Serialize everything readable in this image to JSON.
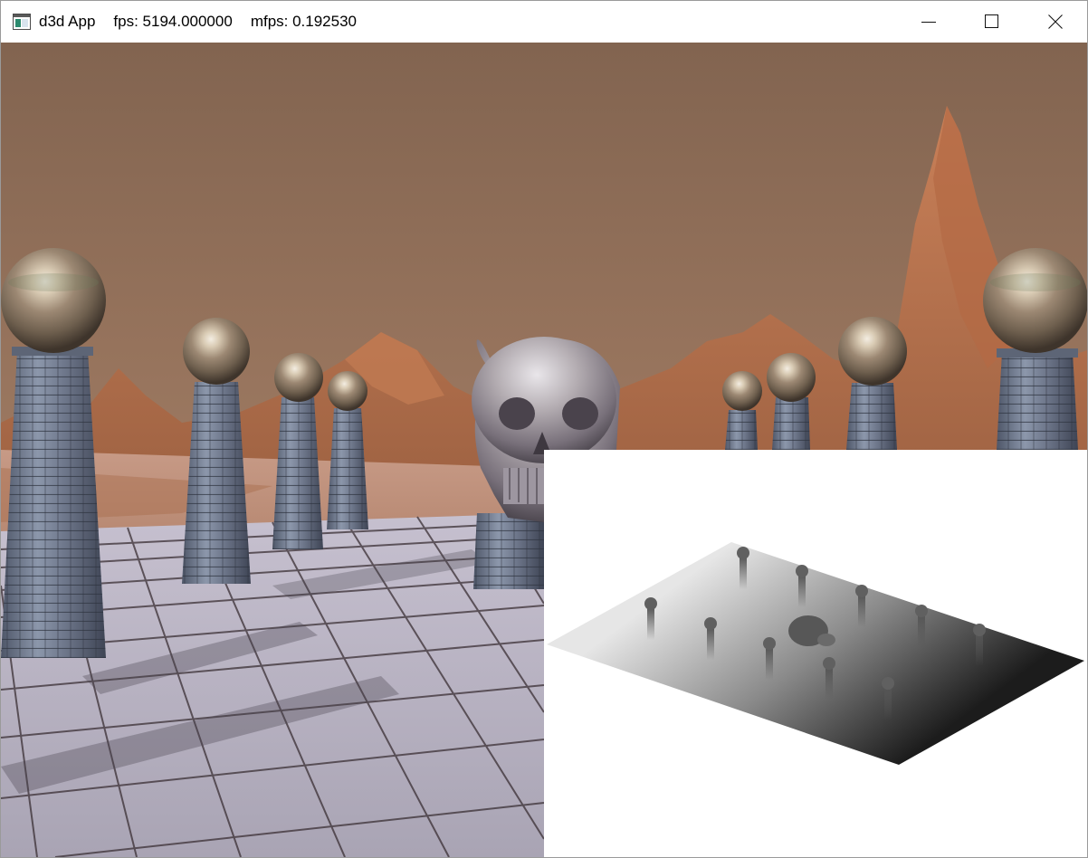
{
  "window": {
    "app_name": "d3d App",
    "fps_text": "fps: 5194.000000",
    "mfps_text": "mfps: 0.192530",
    "icon": "app-window-icon",
    "controls": {
      "minimize_icon": "minimize-icon",
      "maximize_icon": "maximize-icon",
      "close_icon": "close-icon"
    }
  },
  "scene": {
    "sky_color": "#8c6a54",
    "ground_color": "#b7b2c0",
    "mountain_color": "#b3704b",
    "pillar_count": 10,
    "sphere_count": 10,
    "objects": [
      "stone-pillar",
      "chrome-sphere",
      "chrome-skull",
      "tiled-floor",
      "rocky-mountains"
    ]
  },
  "debug_view": {
    "name": "shadow-map-preview",
    "background_color": "#ffffff"
  }
}
